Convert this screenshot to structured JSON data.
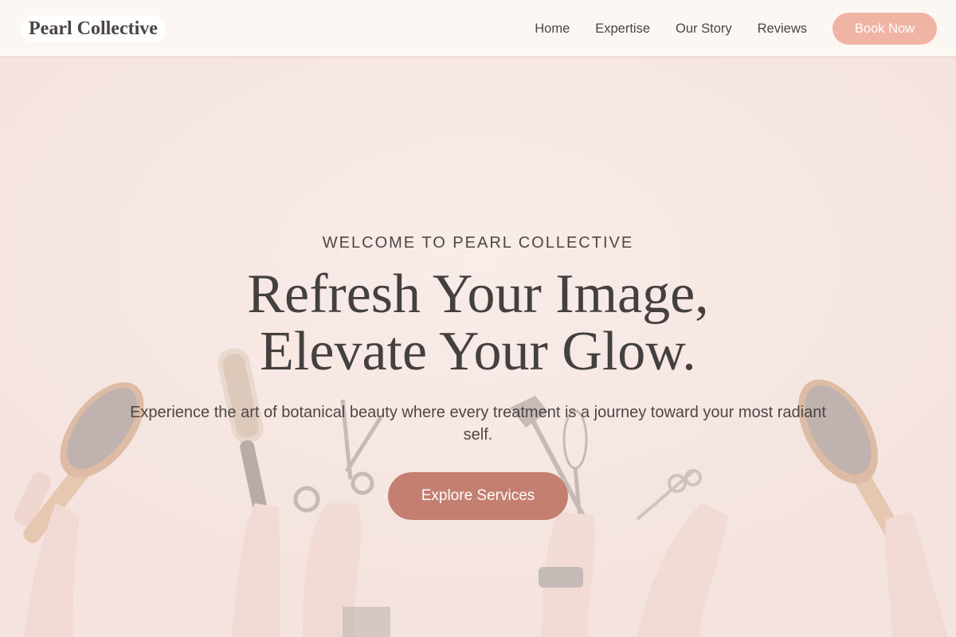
{
  "header": {
    "logo_text": "Pearl Collective",
    "nav": [
      {
        "label": "Home"
      },
      {
        "label": "Expertise"
      },
      {
        "label": "Our Story"
      },
      {
        "label": "Reviews"
      }
    ],
    "cta_label": "Book Now"
  },
  "hero": {
    "eyebrow": "WELCOME TO PEARL COLLECTIVE",
    "headline_line1": "Refresh Your Image,",
    "headline_line2": "Elevate Your Glow.",
    "subtext": "Experience the art of botanical beauty where every treatment is a journey toward your most radiant self.",
    "cta_label": "Explore Services",
    "background_image": "hands-holding-hair-tools-photo"
  },
  "colors": {
    "header_bg": "#fdf7f4",
    "hero_overlay": "#f7e9e5",
    "book_button": "#f0b4a5",
    "explore_button": "#c47f70",
    "text": "#4a4443"
  }
}
